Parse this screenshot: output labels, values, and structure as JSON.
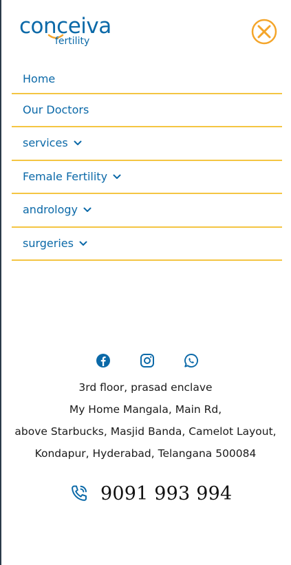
{
  "logo": {
    "wordmark": "conceiva",
    "subtitle": "fertility",
    "brand_color": "#0b69a8",
    "accent_color": "#f4a52a"
  },
  "header": {
    "close_icon": "close-circle-icon"
  },
  "menu": {
    "divider_color": "#f4c542",
    "items": [
      {
        "label": "Home",
        "has_dropdown": false
      },
      {
        "label": "Our Doctors",
        "has_dropdown": false
      },
      {
        "label": "services",
        "has_dropdown": true
      },
      {
        "label": "Female Fertility",
        "has_dropdown": true
      },
      {
        "label": "andrology",
        "has_dropdown": true
      },
      {
        "label": "surgeries",
        "has_dropdown": true
      }
    ]
  },
  "social": {
    "icons": [
      "facebook-icon",
      "instagram-icon",
      "whatsapp-icon"
    ]
  },
  "address": {
    "lines": [
      "3rd floor, prasad enclave",
      "My Home Mangala, Main Rd,",
      "above Starbucks, Masjid Banda, Camelot Layout,",
      "Kondapur, Hyderabad, Telangana 500084"
    ]
  },
  "contact": {
    "phone_icon": "phone-icon",
    "phone": "9091 993 994"
  }
}
